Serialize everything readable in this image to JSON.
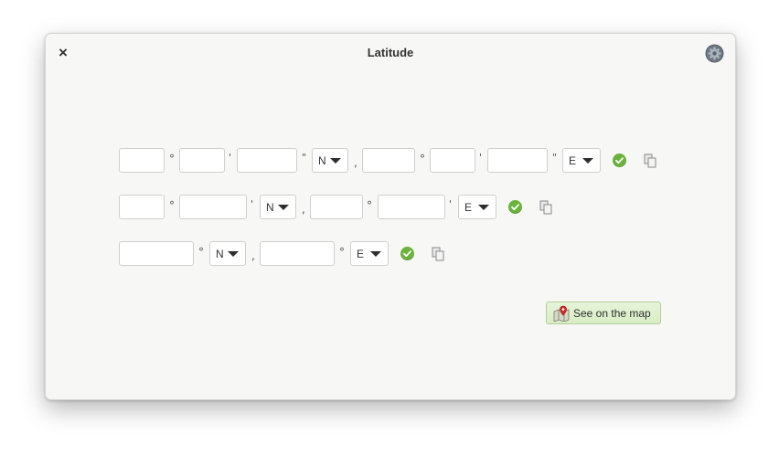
{
  "window": {
    "title": "Latitude"
  },
  "header": {
    "close_glyph": "×",
    "settings_icon": "gear-icon"
  },
  "rows": [
    {
      "format": "degrees-minutes-seconds",
      "lat": {
        "degrees": "",
        "minutes": "",
        "seconds": "",
        "hemisphere": "N"
      },
      "lon": {
        "degrees": "",
        "minutes": "",
        "seconds": "",
        "hemisphere": "E"
      },
      "status_icon": "check-circle-icon",
      "copy_icon": "copy-icon"
    },
    {
      "format": "degrees-decimal-minutes",
      "lat": {
        "degrees": "",
        "minutes": "",
        "hemisphere": "N"
      },
      "lon": {
        "degrees": "",
        "minutes": "",
        "hemisphere": "E"
      },
      "status_icon": "check-circle-icon",
      "copy_icon": "copy-icon"
    },
    {
      "format": "decimal-degrees",
      "lat": {
        "degrees": "",
        "hemisphere": "N"
      },
      "lon": {
        "degrees": "",
        "hemisphere": "E"
      },
      "status_icon": "check-circle-icon",
      "copy_icon": "copy-icon"
    }
  ],
  "symbols": {
    "degree": "°",
    "minute": "'",
    "second": "\"",
    "comma": ","
  },
  "map_button": {
    "label": "See on the map",
    "icon": "map-pin-icon"
  },
  "colors": {
    "check": "#6cb33e",
    "map_button_bg": "#e3f2d5",
    "map_pin": "#d62b2b"
  }
}
